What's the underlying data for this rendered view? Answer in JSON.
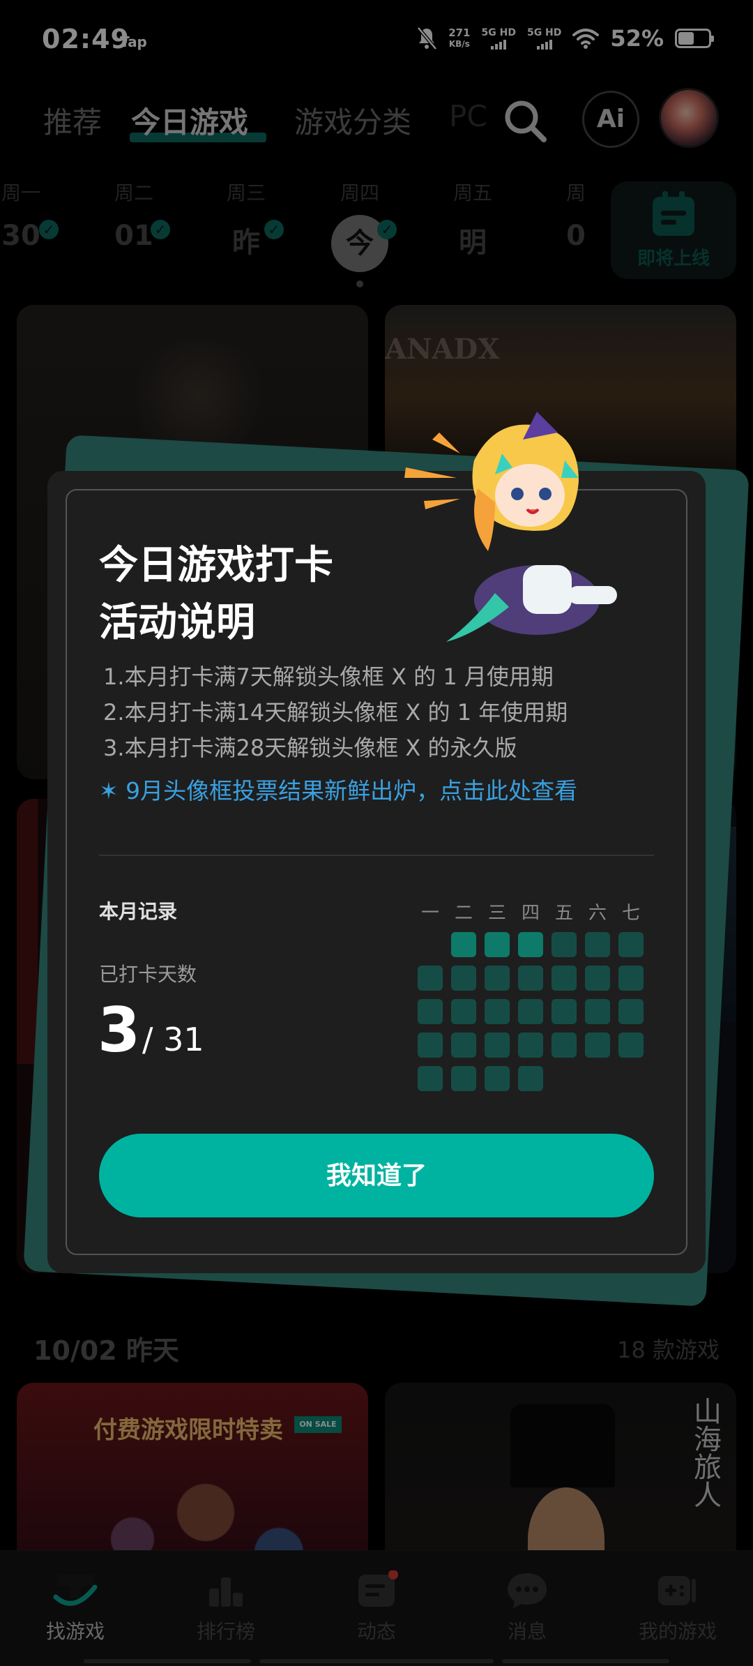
{
  "status": {
    "time": "02:49",
    "tap": "Tap",
    "speed_value": "271",
    "speed_unit": "KB/s",
    "net1": "5G HD",
    "net2": "5G HD",
    "battery": "52%"
  },
  "nav": {
    "tabs": [
      "推荐",
      "今日游戏",
      "游戏分类"
    ],
    "pc": "PC",
    "ai": "Ai"
  },
  "days": [
    {
      "name": "周一",
      "num": "30"
    },
    {
      "name": "周二",
      "num": "01"
    },
    {
      "name": "周三",
      "num": "昨"
    },
    {
      "name": "周四",
      "num": "今"
    },
    {
      "name": "周五",
      "num": "明"
    },
    {
      "name": "周",
      "num": "0"
    }
  ],
  "upcoming": {
    "label": "即将上线"
  },
  "cards": {
    "fanad": "ANADX",
    "sale_title": "付费游戏限时特卖",
    "sale_badge": "ON SALE",
    "callig": "山海旅人"
  },
  "modal": {
    "title_line1": "今日游戏打卡",
    "title_line2": "活动说明",
    "rule1": "1.本月打卡满7天解锁头像框 X 的 1 月使用期",
    "rule2": "2.本月打卡满14天解锁头像框 X 的 1 年使用期",
    "rule3": "3.本月打卡满28天解锁头像框 X 的永久版",
    "notice": "✶ 9月头像框投票结果新鲜出炉，点击此处查看",
    "month_label": "本月记录",
    "days_label": "已打卡天数",
    "checked": "3",
    "total": "/ 31",
    "weekdays": [
      "一",
      "二",
      "三",
      "四",
      "五",
      "六",
      "七"
    ],
    "ok": "我知道了"
  },
  "calendar": {
    "offset": 1,
    "days_in_month": 31,
    "checked_days": [
      1,
      2,
      3
    ]
  },
  "section": {
    "title": "10/02 昨天",
    "count": "18 款游戏"
  },
  "bottom_nav": [
    "找游戏",
    "排行榜",
    "动态",
    "消息",
    "我的游戏"
  ],
  "colors": {
    "accent": "#00b3a0",
    "link": "#3aa0e0",
    "checked_cell": "#0e7a6a",
    "unchecked_cell": "#154d46"
  }
}
